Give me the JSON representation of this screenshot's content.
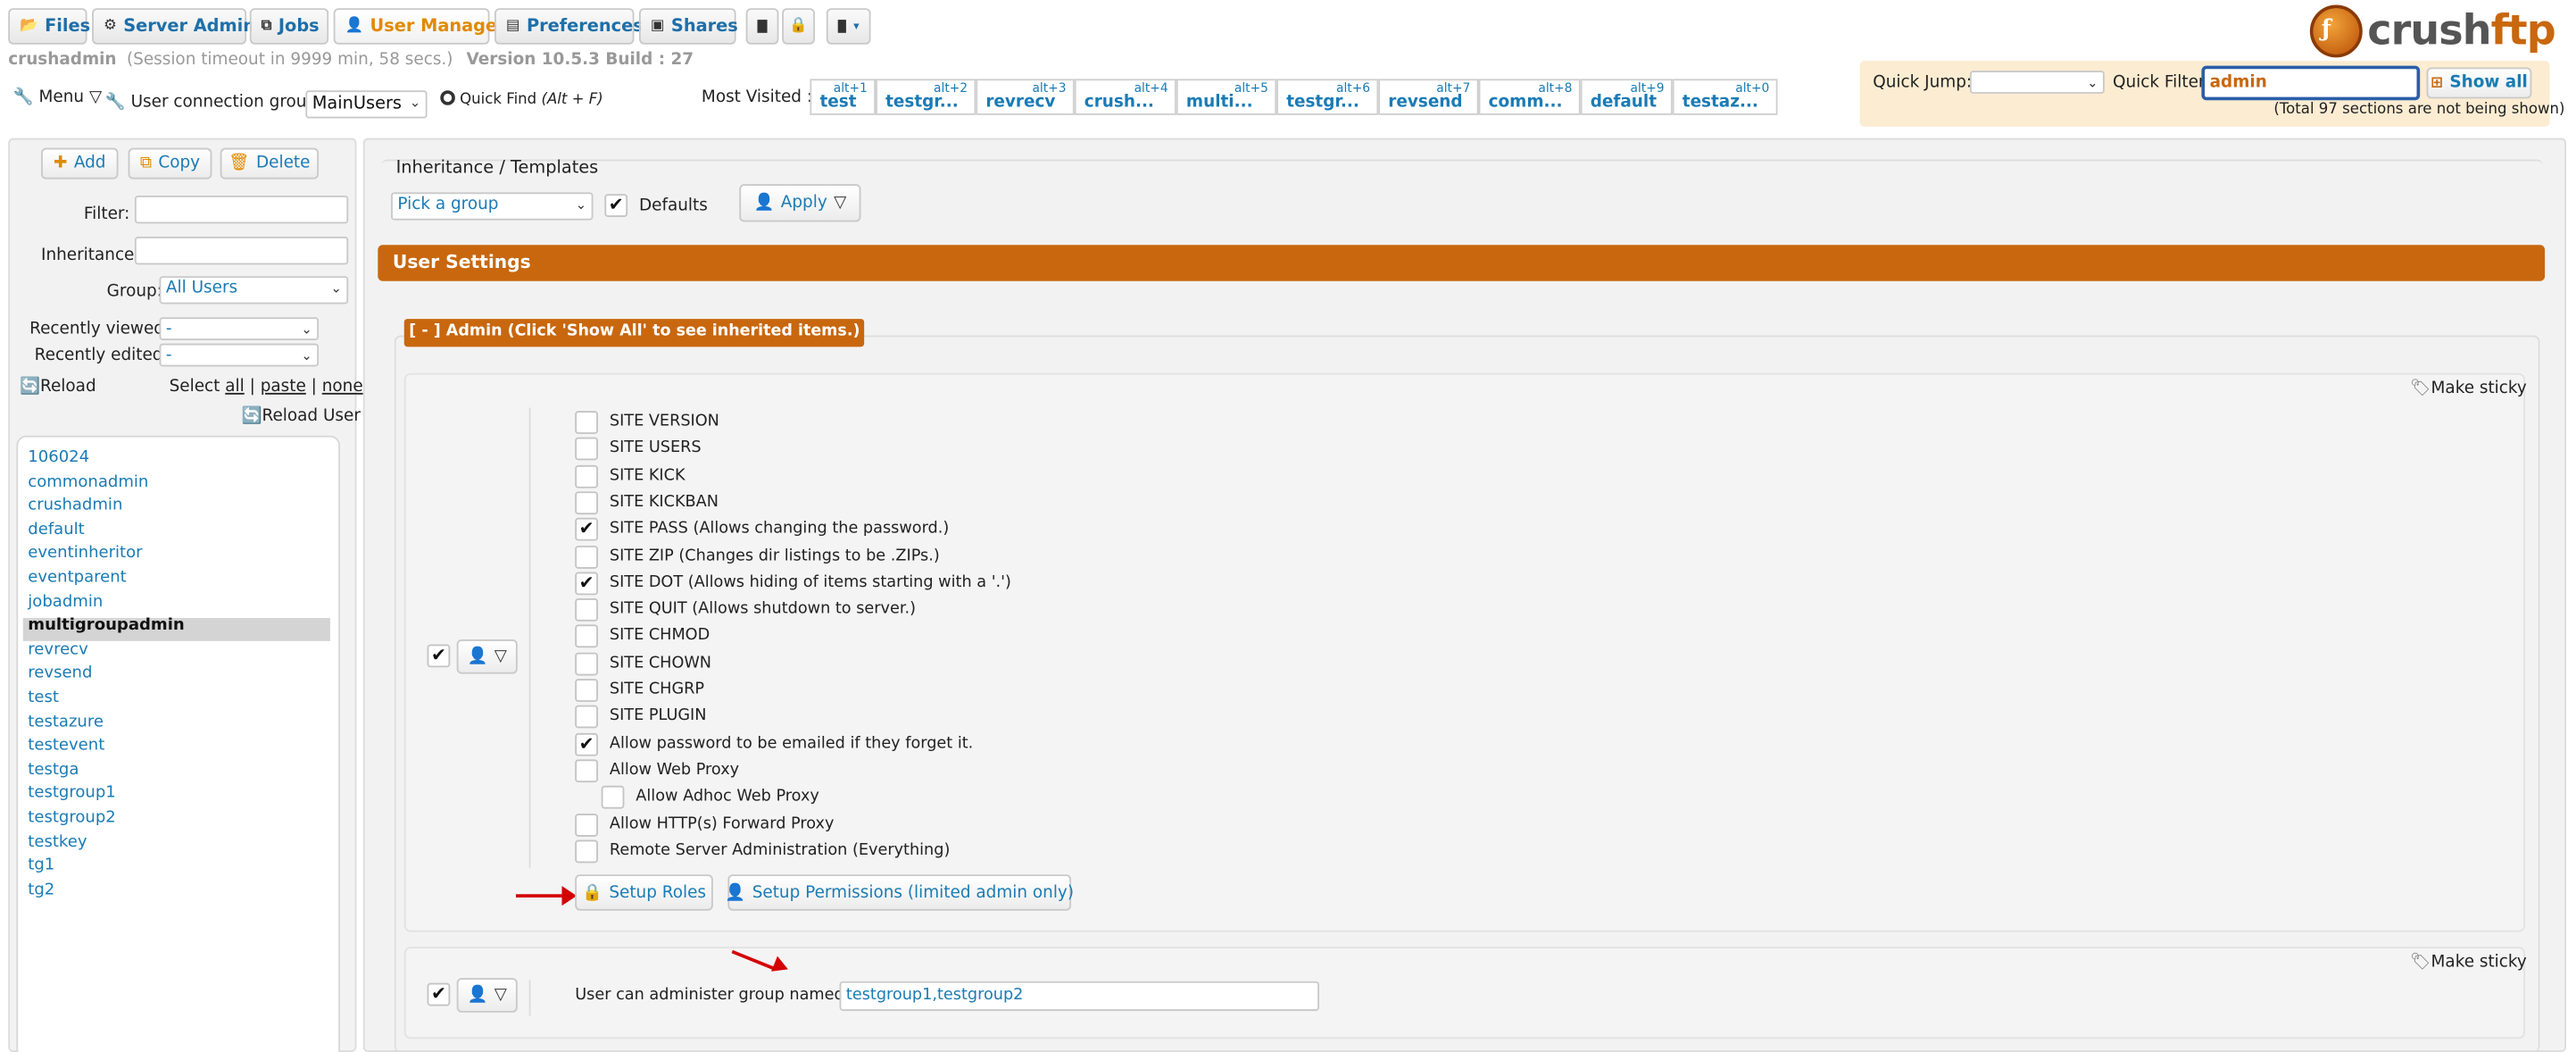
{
  "tabs": [
    {
      "label": "Files",
      "icon": "folder-open-icon",
      "glyph": "📂"
    },
    {
      "label": "Server Admin",
      "icon": "gear-icon",
      "glyph": "⚙"
    },
    {
      "label": "Jobs",
      "icon": "copy-icon",
      "glyph": "⧉"
    },
    {
      "label": "User Manager",
      "icon": "user-icon",
      "glyph": "👤"
    },
    {
      "label": "Preferences",
      "icon": "document-icon",
      "glyph": "▤"
    },
    {
      "label": "Shares",
      "icon": "book-icon",
      "glyph": "▣"
    }
  ],
  "toolbar_icons": [
    "terminal-icon",
    "lock-icon",
    "image-dropdown-icon"
  ],
  "logo": {
    "text": "crush",
    "text_accent": "ftp"
  },
  "session": {
    "user": "crushadmin",
    "timeout": "(Session timeout in 9999 min, 58 secs.)",
    "version": "Version 10.5.3 Build : 27"
  },
  "menu": {
    "label": "Menu",
    "connection_group_label": "User connection group:",
    "connection_group_value": "MainUsers",
    "quick_find": "Quick Find",
    "quick_find_hint": "(Alt + F)"
  },
  "most_visited": {
    "label": "Most Visited :",
    "items": [
      {
        "key": "alt+1",
        "label": "test"
      },
      {
        "key": "alt+2",
        "label": "testgr..."
      },
      {
        "key": "alt+3",
        "label": "revrecv"
      },
      {
        "key": "alt+4",
        "label": "crush..."
      },
      {
        "key": "alt+5",
        "label": "multi..."
      },
      {
        "key": "alt+6",
        "label": "testgr..."
      },
      {
        "key": "alt+7",
        "label": "revsend"
      },
      {
        "key": "alt+8",
        "label": "comm..."
      },
      {
        "key": "alt+9",
        "label": "default"
      },
      {
        "key": "alt+0",
        "label": "testaz..."
      }
    ]
  },
  "quick": {
    "jump_label": "Quick Jump:",
    "filter_label": "Quick Filter",
    "filter_value": "admin",
    "show_all": "Show all",
    "note": "(Total 97 sections are not being shown)"
  },
  "sidebar": {
    "add": "Add",
    "copy": "Copy",
    "delete": "Delete",
    "filter_label": "Filter:",
    "inheritance_label": "Inheritance:",
    "group_label": "Group:",
    "group_value": "All Users",
    "recently_viewed_label": "Recently viewed:",
    "recently_viewed_value": "-",
    "recently_edited_label": "Recently edited:",
    "recently_edited_value": "-",
    "reload": "Reload",
    "select": "Select",
    "all": "all",
    "paste": "paste",
    "none": "none",
    "sep": "|",
    "reload_user": "Reload User",
    "users": [
      "106024",
      "commonadmin",
      "crushadmin",
      "default",
      "eventinheritor",
      "eventparent",
      "jobadmin",
      "multigroupadmin",
      "revrecv",
      "revsend",
      "test",
      "testazure",
      "testevent",
      "testga",
      "testgroup1",
      "testgroup2",
      "testkey",
      "tg1",
      "tg2"
    ],
    "selected_user": "multigroupadmin"
  },
  "main": {
    "inheritance_title": "Inheritance / Templates",
    "pick_group": "Pick a group",
    "defaults": "Defaults",
    "apply": "Apply",
    "user_settings": "User Settings",
    "admin_header": "[ - ] Admin (Click 'Show All' to see inherited items.)",
    "make_sticky": "Make sticky",
    "permissions": [
      {
        "label": "SITE VERSION",
        "checked": false
      },
      {
        "label": "SITE USERS",
        "checked": false
      },
      {
        "label": "SITE KICK",
        "checked": false
      },
      {
        "label": "SITE KICKBAN",
        "checked": false
      },
      {
        "label": "SITE PASS (Allows changing the password.)",
        "checked": true
      },
      {
        "label": "SITE ZIP (Changes dir listings to be .ZIPs.)",
        "checked": false
      },
      {
        "label": "SITE DOT (Allows hiding of items starting with a '.')",
        "checked": true
      },
      {
        "label": "SITE QUIT (Allows shutdown to server.)",
        "checked": false
      },
      {
        "label": "SITE CHMOD",
        "checked": false
      },
      {
        "label": "SITE CHOWN",
        "checked": false
      },
      {
        "label": "SITE CHGRP",
        "checked": false
      },
      {
        "label": "SITE PLUGIN",
        "checked": false
      },
      {
        "label": "Allow password to be emailed if they forget it.",
        "checked": true
      },
      {
        "label": "Allow Web Proxy",
        "checked": false
      },
      {
        "label": "Allow Adhoc Web Proxy",
        "checked": false,
        "indent": true
      },
      {
        "label": "Allow HTTP(s) Forward Proxy",
        "checked": false
      },
      {
        "label": "Remote Server Administration (Everything)",
        "checked": false
      }
    ],
    "setup_roles": "Setup Roles",
    "setup_permissions": "Setup Permissions (limited admin only)",
    "admin_group_label": "User can administer group named:",
    "admin_group_value": "testgroup1,testgroup2"
  },
  "colors": {
    "accent": "#c8670e",
    "link": "#1a7bb5",
    "active_tab": "#e08a00",
    "quickbar_bg": "#fbecd2",
    "arrow": "#d40000"
  }
}
